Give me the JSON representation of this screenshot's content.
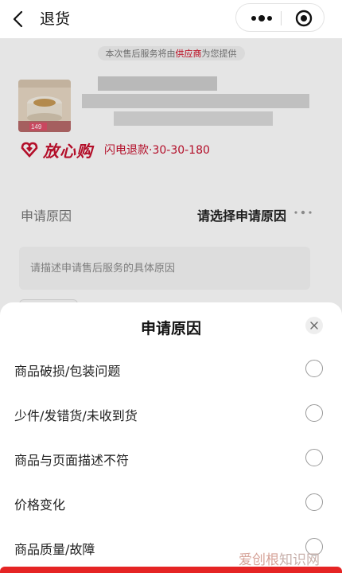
{
  "nav": {
    "title": "退货",
    "back_icon": "chevron-left-icon",
    "more_icon": "more-dots-icon",
    "target_icon": "target-icon"
  },
  "page": {
    "notice_prefix": "本次售后服务将由",
    "notice_supplier": "供应商",
    "notice_suffix": "为您提供",
    "product_badge": "149",
    "trust_brand": "放心购",
    "trust_desc": "闪电退款·30-30-180",
    "reason_label": "申请原因",
    "reason_choose": "请选择申请原因",
    "desc_placeholder": "请描述申请售后服务的具体原因"
  },
  "sheet": {
    "title": "申请原因",
    "options": [
      "商品破损/包装问题",
      "少件/发错货/未收到货",
      "商品与页面描述不符",
      "价格变化",
      "商品质量/故障"
    ]
  },
  "watermark": {
    "part1": "爱创根",
    "part2": "知识网"
  },
  "colors": {
    "accent_red": "#c8102e",
    "bottom_button_red": "#e52424"
  }
}
